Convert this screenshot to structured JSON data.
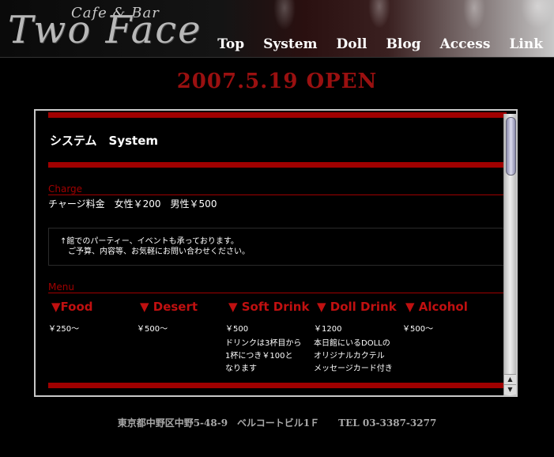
{
  "header": {
    "logo_small": "Cafe & Bar",
    "logo_big": "Two Face",
    "nav": [
      "Top",
      "System",
      "Doll",
      "Blog",
      "Access",
      "Link"
    ]
  },
  "banner": "2007.5.19 OPEN",
  "content": {
    "title": "システム　System",
    "charge": {
      "label": "Charge",
      "text": "チャージ料金　女性￥200　男性￥500"
    },
    "notice": {
      "line1": "↑館でのパーティー、イベントも承っております。",
      "line2": "　ご予算、内容等、お気軽にお問い合わせください。"
    },
    "menu": {
      "label": "Menu",
      "items": [
        {
          "name": "▼Food",
          "price": "￥250～",
          "desc": ""
        },
        {
          "name": "▼ Desert",
          "price": "￥500～",
          "desc": ""
        },
        {
          "name": "▼ Soft Drink",
          "price": "￥500",
          "desc1": "ドリンクは3杯目から",
          "desc2": "1杯につき￥100と",
          "desc3": "なります"
        },
        {
          "name": "▼ Doll Drink",
          "price": "￥1200",
          "desc1": "本日館にいるDOLLの",
          "desc2": "オリジナルカクテル",
          "desc3": "メッセージカード付き"
        },
        {
          "name": "▼ Alcohol",
          "price": "￥500～",
          "desc": ""
        }
      ]
    }
  },
  "footer": "東京都中野区中野5-48-9　ベルコートビル1Ｆ　　TEL 03-3387-3277",
  "colors": {
    "accent": "#a00000",
    "background": "#000000"
  }
}
